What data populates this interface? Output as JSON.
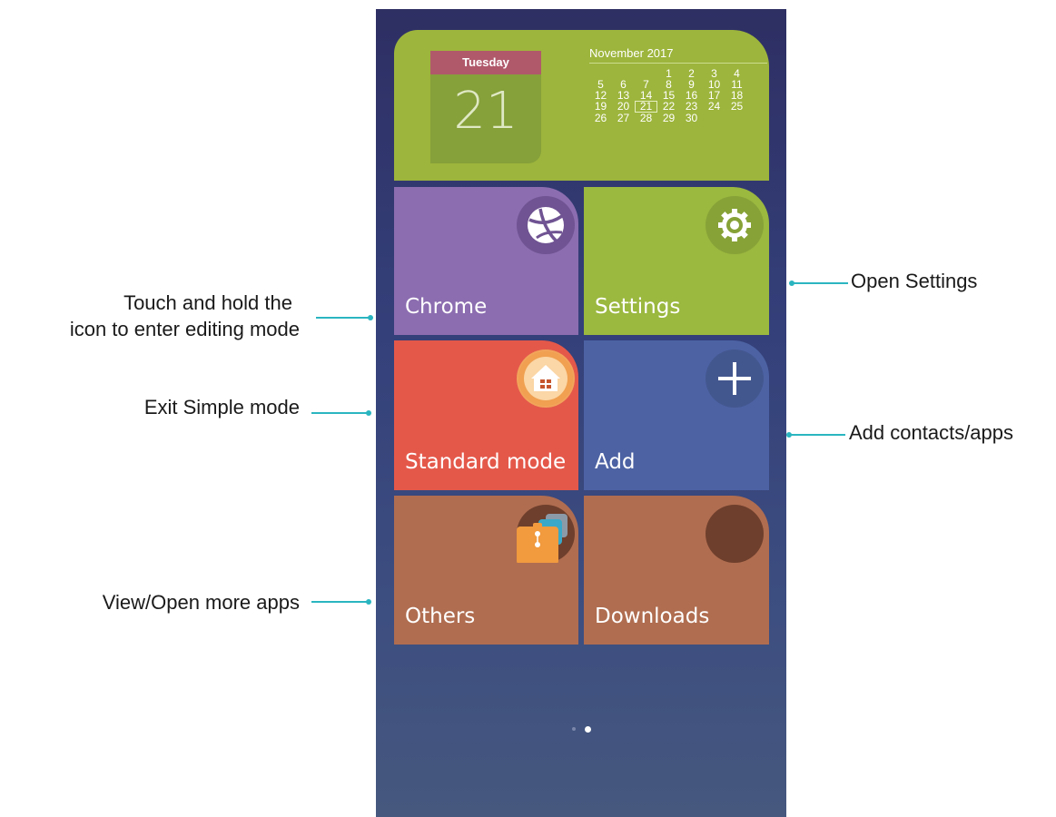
{
  "calendar": {
    "weekday": "Tuesday",
    "day": "21",
    "month_title": "November 2017",
    "weeks": [
      [
        "",
        "",
        "",
        "1",
        "2",
        "3",
        "4"
      ],
      [
        "5",
        "6",
        "7",
        "8",
        "9",
        "10",
        "11"
      ],
      [
        "12",
        "13",
        "14",
        "15",
        "16",
        "17",
        "18"
      ],
      [
        "19",
        "20",
        "21",
        "22",
        "23",
        "24",
        "25"
      ],
      [
        "26",
        "27",
        "28",
        "29",
        "30",
        "",
        ""
      ]
    ],
    "today": "21"
  },
  "tiles": {
    "chrome": {
      "label": "Chrome",
      "icon": "chrome-icon",
      "color": "#8c6db0"
    },
    "settings": {
      "label": "Settings",
      "icon": "gear-icon",
      "color": "#9bb83f"
    },
    "standard_mode": {
      "label": "Standard mode",
      "icon": "home-icon",
      "color": "#e4584a"
    },
    "add": {
      "label": "Add",
      "icon": "plus-icon",
      "color": "#4c62a3"
    },
    "others": {
      "label": "Others",
      "icon": "folder-icon",
      "color": "#b06d50"
    },
    "downloads": {
      "label": "Downloads",
      "icon": "download-icon",
      "color": "#b06d50"
    }
  },
  "pager": {
    "pages": 2,
    "current": 2
  },
  "annotations": {
    "edit_mode_line1": "Touch and hold the",
    "edit_mode_line2": "icon to enter editing mode",
    "exit_simple": "Exit Simple mode",
    "more_apps": "View/Open more apps",
    "open_settings": "Open Settings",
    "add_contacts": "Add contacts/apps"
  },
  "colors": {
    "callout_line": "#2ab5c0"
  }
}
